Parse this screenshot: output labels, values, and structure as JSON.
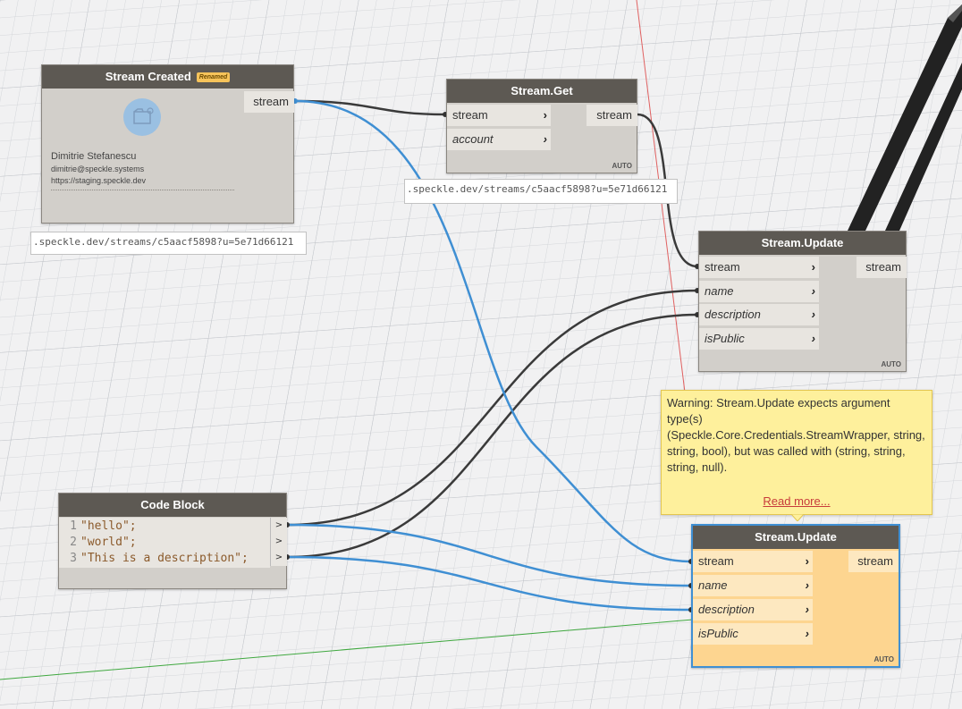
{
  "colors": {
    "accent_blue": "#3f8fd3",
    "wire_dark": "#3a3a3a",
    "header_bg": "#5d5953",
    "warning_bg": "#fef09c",
    "selected_bg": "#fdd590"
  },
  "nodes": {
    "stream_created": {
      "title": "Stream Created",
      "badge": "Renamed",
      "output": "stream",
      "account_icon": "stream-icon",
      "user_name": "Dimitrie Stefanescu",
      "user_email": "dimitrie@speckle.systems",
      "server_url": "https://staging.speckle.dev",
      "preview": ".speckle.dev/streams/c5aacf5898?u=5e71d66121"
    },
    "stream_get": {
      "title": "Stream.Get",
      "inputs": [
        "stream",
        "account"
      ],
      "output": "stream",
      "lacing": "AUTO",
      "preview": ".speckle.dev/streams/c5aacf5898?u=5e71d66121"
    },
    "stream_update_1": {
      "title": "Stream.Update",
      "inputs": [
        "stream",
        "name",
        "description",
        "isPublic"
      ],
      "output": "stream",
      "lacing": "AUTO"
    },
    "code_block": {
      "title": "Code Block",
      "lines": [
        {
          "num": "1",
          "text": "\"hello\";"
        },
        {
          "num": "2",
          "text": "\"world\";"
        },
        {
          "num": "3",
          "text": "\"This is a description\";"
        }
      ],
      "port_glyph": ">"
    },
    "stream_update_2": {
      "title": "Stream.Update",
      "inputs": [
        "stream",
        "name",
        "description",
        "isPublic"
      ],
      "output": "stream",
      "lacing": "AUTO"
    }
  },
  "warning": {
    "message": "Warning: Stream.Update expects argument type(s) (Speckle.Core.Credentials.StreamWrapper, string, string, bool), but was called with (string, string, string, null).",
    "link": "Read more..."
  }
}
